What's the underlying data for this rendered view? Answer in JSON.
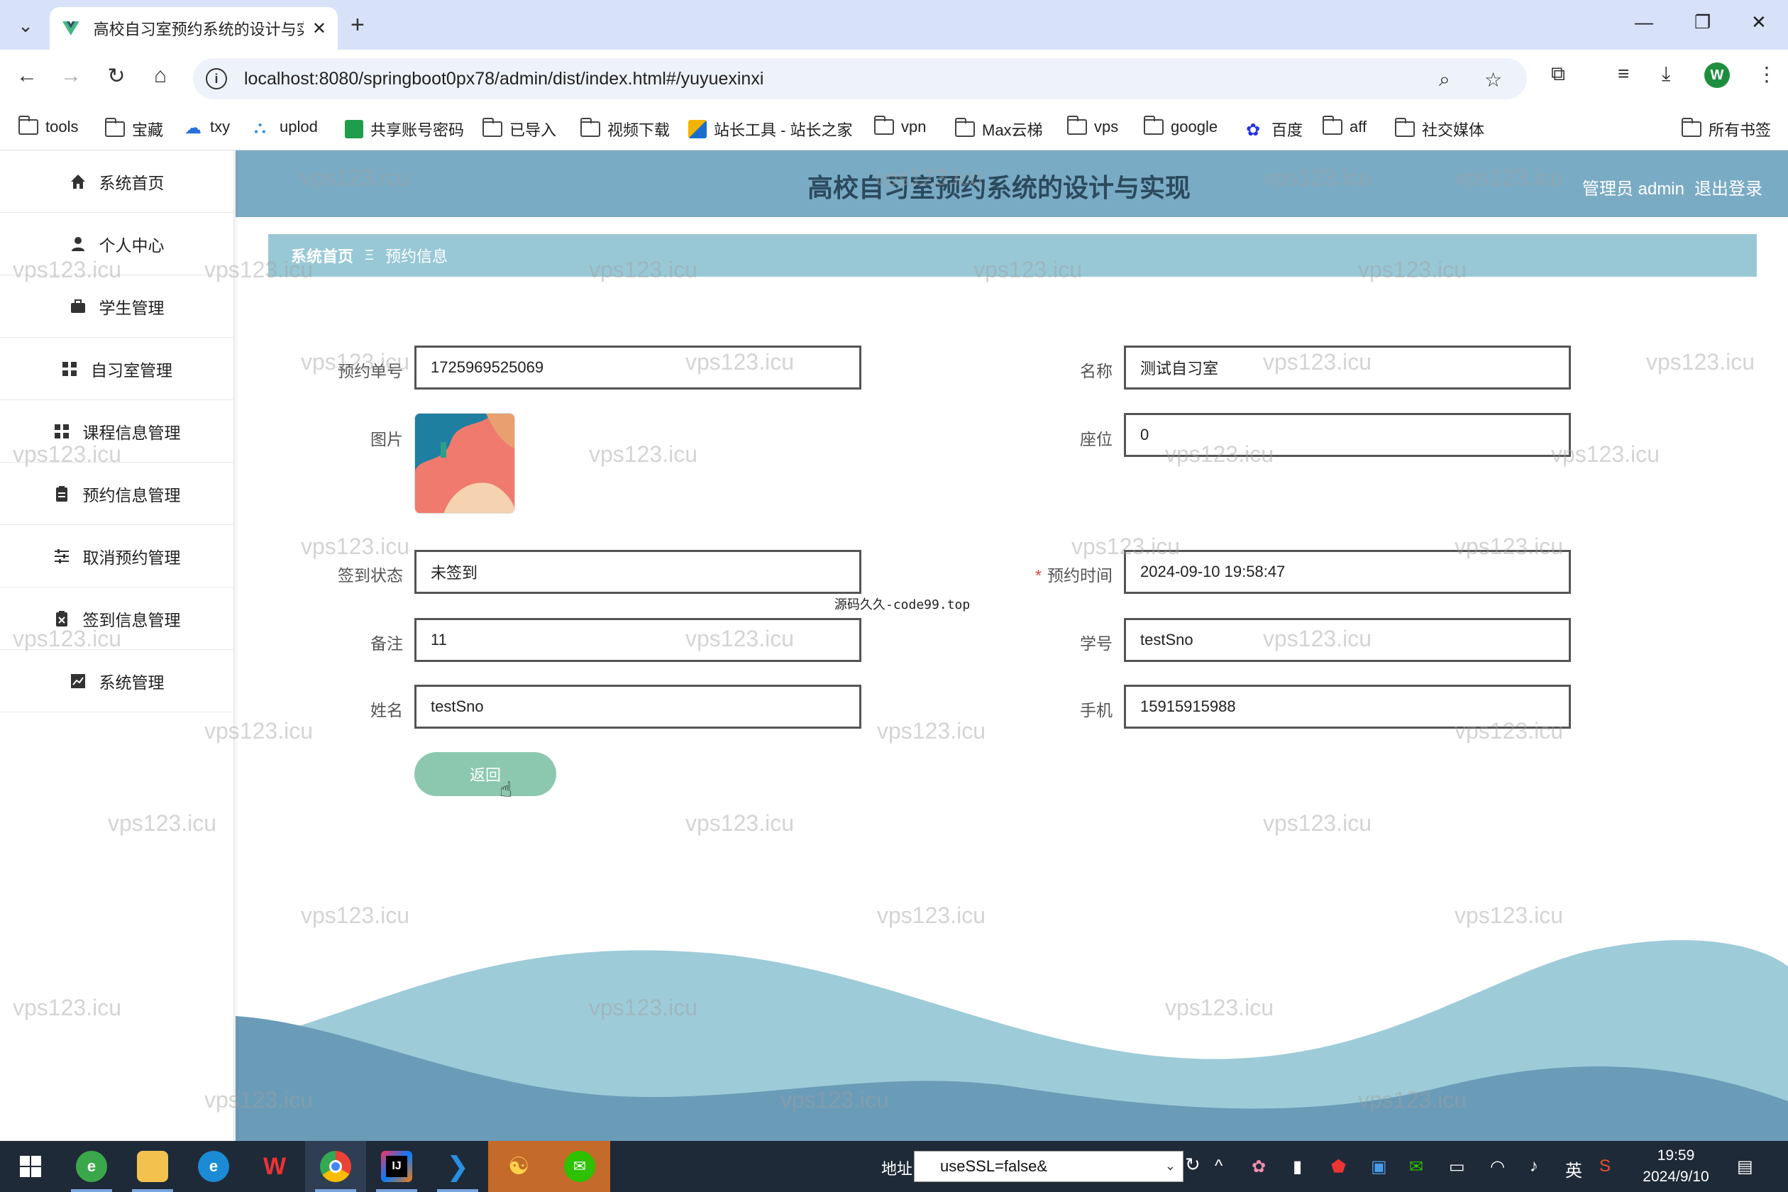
{
  "browser": {
    "tab_title": "高校自习室预约系统的设计与实现",
    "url": "localhost:8080/springboot0px78/admin/dist/index.html#/yuyuexinxi",
    "bookmarks": [
      "tools",
      "宝藏",
      "txy",
      "uplod",
      "共享账号密码",
      "已导入",
      "视频下载",
      "站长工具 - 站长之家",
      "vpn",
      "Max云梯",
      "vps",
      "google",
      "百度",
      "aff",
      "社交媒体"
    ],
    "all_bookmarks": "所有书签",
    "profile_initial": "W"
  },
  "header": {
    "title": "高校自习室预约系统的设计与实现",
    "user_label": "管理员 admin",
    "logout": "退出登录"
  },
  "sidebar": {
    "items": [
      {
        "label": "系统首页",
        "icon": "home-icon"
      },
      {
        "label": "个人中心",
        "icon": "user-icon"
      },
      {
        "label": "学生管理",
        "icon": "briefcase-icon"
      },
      {
        "label": "自习室管理",
        "icon": "grid-icon"
      },
      {
        "label": "课程信息管理",
        "icon": "grid-icon"
      },
      {
        "label": "预约信息管理",
        "icon": "clipboard-icon"
      },
      {
        "label": "取消预约管理",
        "icon": "sliders-icon"
      },
      {
        "label": "签到信息管理",
        "icon": "clipboard-x-icon"
      },
      {
        "label": "系统管理",
        "icon": "chart-icon"
      }
    ]
  },
  "breadcrumb": {
    "home": "系统首页",
    "separator": "Ξ",
    "current": "预约信息"
  },
  "form": {
    "booking_no_label": "预约单号",
    "booking_no": "1725969525069",
    "name_label": "名称",
    "name": "测试自习室",
    "image_label": "图片",
    "seat_label": "座位",
    "seat": "0",
    "checkin_label": "签到状态",
    "checkin": "未签到",
    "time_label": "预约时间",
    "time_required": "*",
    "time": "2024-09-10 19:58:47",
    "remark_label": "备注",
    "remark": "11",
    "student_no_label": "学号",
    "student_no": "testSno",
    "student_name_label": "姓名",
    "student_name": "testSno",
    "phone_label": "手机",
    "phone": "15915915988",
    "back_button": "返回"
  },
  "overlay_text": "源码久久-code99.top",
  "watermark": "vps123.icu",
  "taskbar": {
    "addr_label": "地址",
    "addr_value": "useSSL=false&",
    "ime": "英",
    "time": "19:59",
    "date": "2024/9/10"
  },
  "colors": {
    "header": "#7aabc4",
    "breadcrumb": "#98c8d6",
    "button": "#8cc8b0",
    "wave_dark": "#6a9cb8",
    "wave_light": "#9ecbd8"
  }
}
